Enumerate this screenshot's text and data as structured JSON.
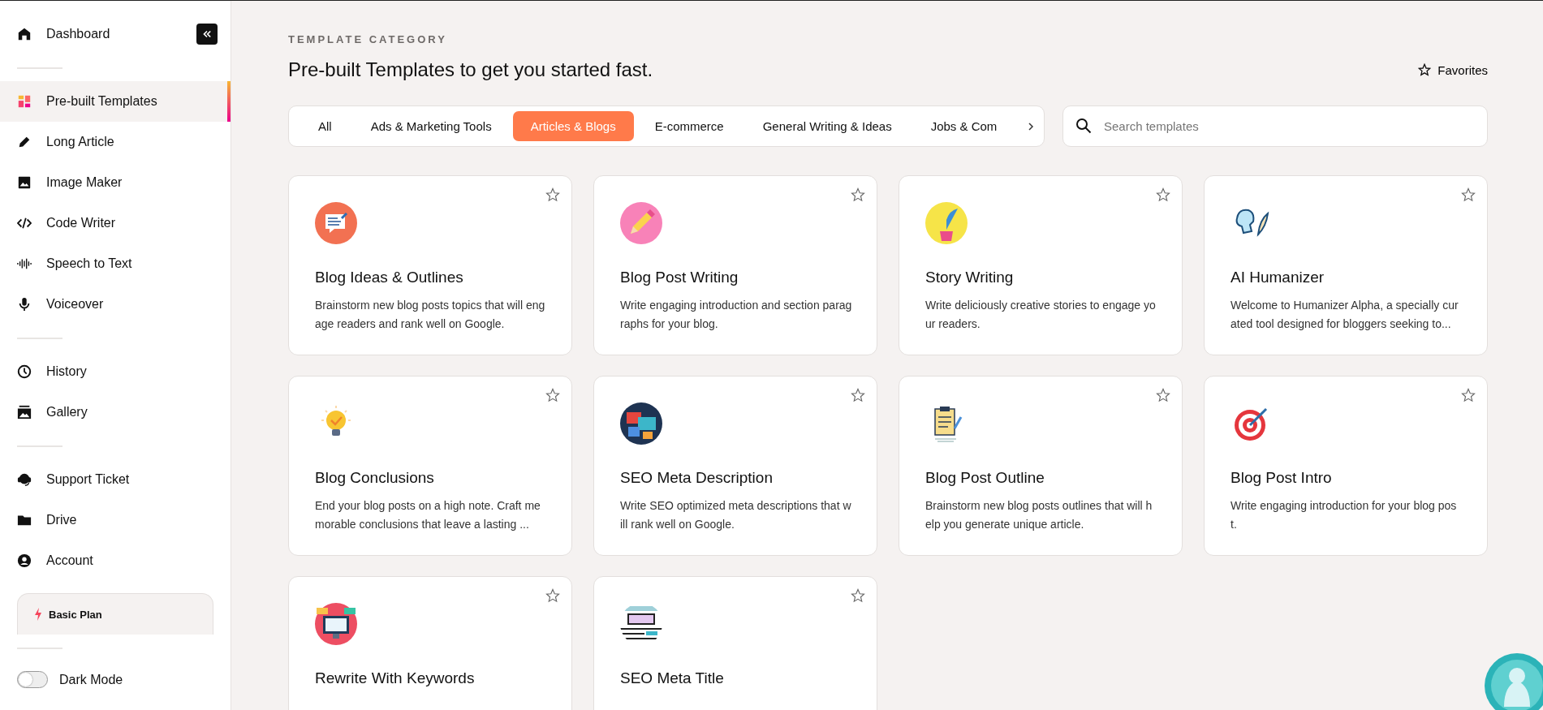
{
  "sidebar": {
    "top": {
      "label": "Dashboard"
    },
    "sections": [
      {
        "items": [
          {
            "label": "Pre-built Templates",
            "selected": true
          },
          {
            "label": "Long Article",
            "selected": false
          },
          {
            "label": "Image Maker",
            "selected": false
          },
          {
            "label": "Code Writer",
            "selected": false
          },
          {
            "label": "Speech to Text",
            "selected": false
          },
          {
            "label": "Voiceover",
            "selected": false
          }
        ]
      },
      {
        "items": [
          {
            "label": "History",
            "selected": false
          },
          {
            "label": "Gallery",
            "selected": false
          }
        ]
      },
      {
        "items": [
          {
            "label": "Support Ticket",
            "selected": false
          },
          {
            "label": "Drive",
            "selected": false
          },
          {
            "label": "Account",
            "selected": false
          }
        ]
      }
    ],
    "plan": {
      "label": "Basic Plan"
    },
    "dark_mode": {
      "label": "Dark Mode",
      "on": false
    }
  },
  "header": {
    "eyebrow": "TEMPLATE CATEGORY",
    "title": "Pre-built Templates to get you started fast.",
    "favorites": "Favorites"
  },
  "tabs": [
    {
      "label": "All",
      "selected": false
    },
    {
      "label": "Ads & Marketing Tools",
      "selected": false
    },
    {
      "label": "Articles & Blogs",
      "selected": true
    },
    {
      "label": "E-commerce",
      "selected": false
    },
    {
      "label": "General Writing & Ideas",
      "selected": false
    },
    {
      "label": "Jobs & Com",
      "selected": false
    }
  ],
  "search": {
    "placeholder": "Search templates"
  },
  "cards": [
    {
      "title": "Blog Ideas & Outlines",
      "description": "Brainstorm new blog posts topics that will engage readers and rank well on Google.",
      "favorite": false
    },
    {
      "title": "Blog Post Writing",
      "description": "Write engaging introduction and section paragraphs for your blog.",
      "favorite": false
    },
    {
      "title": "Story Writing",
      "description": "Write deliciously creative stories to engage your readers.",
      "favorite": false
    },
    {
      "title": "AI Humanizer",
      "description": "Welcome to Humanizer Alpha, a specially curated tool designed for bloggers seeking to...",
      "favorite": false
    },
    {
      "title": "Blog Conclusions",
      "description": "End your blog posts on a high note. Craft memorable conclusions that leave a lasting ...",
      "favorite": false
    },
    {
      "title": "SEO Meta Description",
      "description": "Write SEO optimized meta descriptions that will rank well on Google.",
      "favorite": false
    },
    {
      "title": "Blog Post Outline",
      "description": "Brainstorm new blog posts outlines that will help you generate unique article.",
      "favorite": false
    },
    {
      "title": "Blog Post Intro",
      "description": "Write engaging introduction for your blog post.",
      "favorite": false
    },
    {
      "title": "Rewrite With Keywords",
      "favorite": false
    },
    {
      "title": "SEO Meta Title",
      "favorite": false
    }
  ]
}
